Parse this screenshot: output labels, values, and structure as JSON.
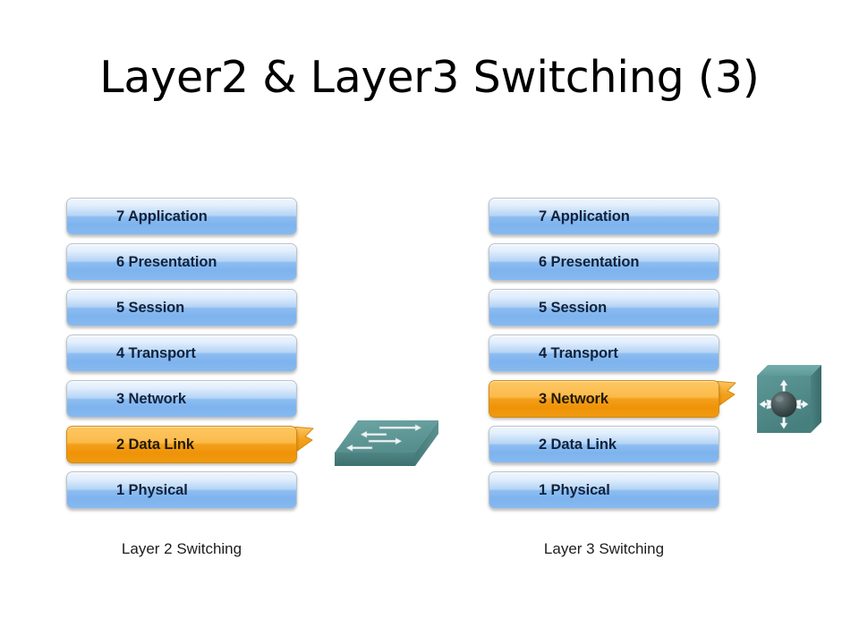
{
  "slide": {
    "title": "Layer2 & Layer3 Switching (3)",
    "background_color": "#ffffff"
  },
  "colors": {
    "layer_blue_top": "#eef5fe",
    "layer_blue_bottom": "#86b9ef",
    "layer_orange_top": "#fdc763",
    "layer_orange_bottom": "#f09a10",
    "layer_text": "#11223d",
    "device_teal_top": "#5f9a99",
    "device_teal_front": "#4a8180",
    "device_teal_side": "#3f7170",
    "arrow_white": "#f2f6f6",
    "title_text": "#000000",
    "caption_text": "#1d1d1d"
  },
  "diagrams": [
    {
      "id": "layer2",
      "caption": "Layer 2 Switching",
      "highlight_layer": "2 Data Link",
      "device_icon": "layer2-switch-icon",
      "layers": [
        {
          "number": "7",
          "name": "Application",
          "label": "7 Application",
          "highlighted": false
        },
        {
          "number": "6",
          "name": "Presentation",
          "label": "6 Presentation",
          "highlighted": false
        },
        {
          "number": "5",
          "name": "Session",
          "label": "5 Session",
          "highlighted": false
        },
        {
          "number": "4",
          "name": "Transport",
          "label": "4 Transport",
          "highlighted": false
        },
        {
          "number": "3",
          "name": "Network",
          "label": "3 Network",
          "highlighted": false
        },
        {
          "number": "2",
          "name": "Data Link",
          "label": "2 Data Link",
          "highlighted": true
        },
        {
          "number": "1",
          "name": "Physical",
          "label": "1 Physical",
          "highlighted": false
        }
      ]
    },
    {
      "id": "layer3",
      "caption": "Layer 3 Switching",
      "highlight_layer": "3 Network",
      "device_icon": "layer3-switch-icon",
      "layers": [
        {
          "number": "7",
          "name": "Application",
          "label": "7 Application",
          "highlighted": false
        },
        {
          "number": "6",
          "name": "Presentation",
          "label": "6 Presentation",
          "highlighted": false
        },
        {
          "number": "5",
          "name": "Session",
          "label": "5 Session",
          "highlighted": false
        },
        {
          "number": "4",
          "name": "Transport",
          "label": "4 Transport",
          "highlighted": false
        },
        {
          "number": "3",
          "name": "Network",
          "label": "3 Network",
          "highlighted": true
        },
        {
          "number": "2",
          "name": "Data Link",
          "label": "2 Data Link",
          "highlighted": false
        },
        {
          "number": "1",
          "name": "Physical",
          "label": "1 Physical",
          "highlighted": false
        }
      ]
    }
  ]
}
